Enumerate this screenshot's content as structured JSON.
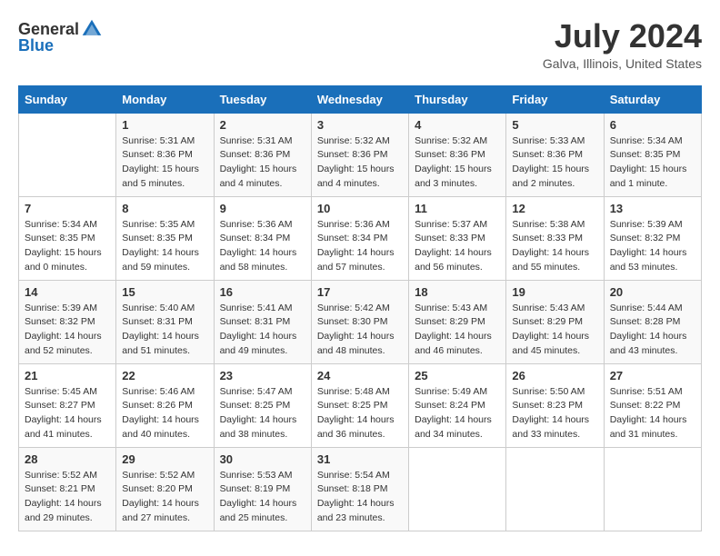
{
  "header": {
    "logo_general": "General",
    "logo_blue": "Blue",
    "month_year": "July 2024",
    "location": "Galva, Illinois, United States"
  },
  "days_of_week": [
    "Sunday",
    "Monday",
    "Tuesday",
    "Wednesday",
    "Thursday",
    "Friday",
    "Saturday"
  ],
  "weeks": [
    [
      {
        "day": "",
        "info": ""
      },
      {
        "day": "1",
        "info": "Sunrise: 5:31 AM\nSunset: 8:36 PM\nDaylight: 15 hours\nand 5 minutes."
      },
      {
        "day": "2",
        "info": "Sunrise: 5:31 AM\nSunset: 8:36 PM\nDaylight: 15 hours\nand 4 minutes."
      },
      {
        "day": "3",
        "info": "Sunrise: 5:32 AM\nSunset: 8:36 PM\nDaylight: 15 hours\nand 4 minutes."
      },
      {
        "day": "4",
        "info": "Sunrise: 5:32 AM\nSunset: 8:36 PM\nDaylight: 15 hours\nand 3 minutes."
      },
      {
        "day": "5",
        "info": "Sunrise: 5:33 AM\nSunset: 8:36 PM\nDaylight: 15 hours\nand 2 minutes."
      },
      {
        "day": "6",
        "info": "Sunrise: 5:34 AM\nSunset: 8:35 PM\nDaylight: 15 hours\nand 1 minute."
      }
    ],
    [
      {
        "day": "7",
        "info": "Sunrise: 5:34 AM\nSunset: 8:35 PM\nDaylight: 15 hours\nand 0 minutes."
      },
      {
        "day": "8",
        "info": "Sunrise: 5:35 AM\nSunset: 8:35 PM\nDaylight: 14 hours\nand 59 minutes."
      },
      {
        "day": "9",
        "info": "Sunrise: 5:36 AM\nSunset: 8:34 PM\nDaylight: 14 hours\nand 58 minutes."
      },
      {
        "day": "10",
        "info": "Sunrise: 5:36 AM\nSunset: 8:34 PM\nDaylight: 14 hours\nand 57 minutes."
      },
      {
        "day": "11",
        "info": "Sunrise: 5:37 AM\nSunset: 8:33 PM\nDaylight: 14 hours\nand 56 minutes."
      },
      {
        "day": "12",
        "info": "Sunrise: 5:38 AM\nSunset: 8:33 PM\nDaylight: 14 hours\nand 55 minutes."
      },
      {
        "day": "13",
        "info": "Sunrise: 5:39 AM\nSunset: 8:32 PM\nDaylight: 14 hours\nand 53 minutes."
      }
    ],
    [
      {
        "day": "14",
        "info": "Sunrise: 5:39 AM\nSunset: 8:32 PM\nDaylight: 14 hours\nand 52 minutes."
      },
      {
        "day": "15",
        "info": "Sunrise: 5:40 AM\nSunset: 8:31 PM\nDaylight: 14 hours\nand 51 minutes."
      },
      {
        "day": "16",
        "info": "Sunrise: 5:41 AM\nSunset: 8:31 PM\nDaylight: 14 hours\nand 49 minutes."
      },
      {
        "day": "17",
        "info": "Sunrise: 5:42 AM\nSunset: 8:30 PM\nDaylight: 14 hours\nand 48 minutes."
      },
      {
        "day": "18",
        "info": "Sunrise: 5:43 AM\nSunset: 8:29 PM\nDaylight: 14 hours\nand 46 minutes."
      },
      {
        "day": "19",
        "info": "Sunrise: 5:43 AM\nSunset: 8:29 PM\nDaylight: 14 hours\nand 45 minutes."
      },
      {
        "day": "20",
        "info": "Sunrise: 5:44 AM\nSunset: 8:28 PM\nDaylight: 14 hours\nand 43 minutes."
      }
    ],
    [
      {
        "day": "21",
        "info": "Sunrise: 5:45 AM\nSunset: 8:27 PM\nDaylight: 14 hours\nand 41 minutes."
      },
      {
        "day": "22",
        "info": "Sunrise: 5:46 AM\nSunset: 8:26 PM\nDaylight: 14 hours\nand 40 minutes."
      },
      {
        "day": "23",
        "info": "Sunrise: 5:47 AM\nSunset: 8:25 PM\nDaylight: 14 hours\nand 38 minutes."
      },
      {
        "day": "24",
        "info": "Sunrise: 5:48 AM\nSunset: 8:25 PM\nDaylight: 14 hours\nand 36 minutes."
      },
      {
        "day": "25",
        "info": "Sunrise: 5:49 AM\nSunset: 8:24 PM\nDaylight: 14 hours\nand 34 minutes."
      },
      {
        "day": "26",
        "info": "Sunrise: 5:50 AM\nSunset: 8:23 PM\nDaylight: 14 hours\nand 33 minutes."
      },
      {
        "day": "27",
        "info": "Sunrise: 5:51 AM\nSunset: 8:22 PM\nDaylight: 14 hours\nand 31 minutes."
      }
    ],
    [
      {
        "day": "28",
        "info": "Sunrise: 5:52 AM\nSunset: 8:21 PM\nDaylight: 14 hours\nand 29 minutes."
      },
      {
        "day": "29",
        "info": "Sunrise: 5:52 AM\nSunset: 8:20 PM\nDaylight: 14 hours\nand 27 minutes."
      },
      {
        "day": "30",
        "info": "Sunrise: 5:53 AM\nSunset: 8:19 PM\nDaylight: 14 hours\nand 25 minutes."
      },
      {
        "day": "31",
        "info": "Sunrise: 5:54 AM\nSunset: 8:18 PM\nDaylight: 14 hours\nand 23 minutes."
      },
      {
        "day": "",
        "info": ""
      },
      {
        "day": "",
        "info": ""
      },
      {
        "day": "",
        "info": ""
      }
    ]
  ]
}
